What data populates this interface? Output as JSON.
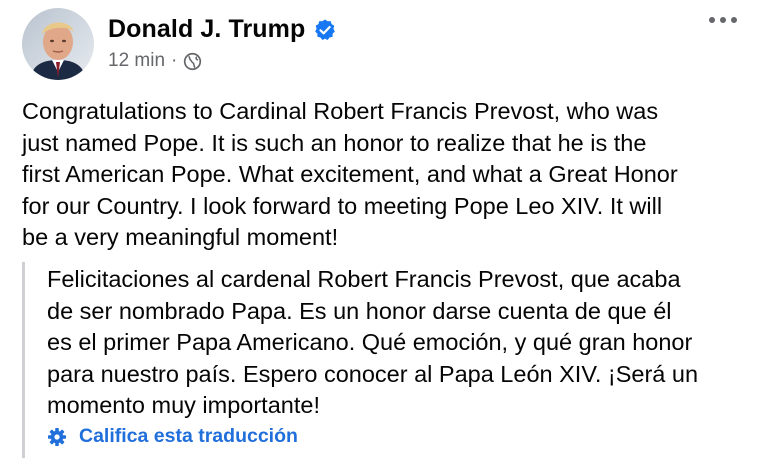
{
  "post": {
    "author": "Donald J. Trump",
    "verified": true,
    "timestamp": "12 min",
    "separator": "·",
    "audience_icon": "globe-icon",
    "more_icon": "more-options-icon",
    "text_lines": [
      "Congratulations to Cardinal Robert Francis Prevost, who was",
      "just named Pope. It is such an honor to realize that he is the",
      "first American Pope. What excitement, and what a Great Honor",
      "for our Country. I look forward to meeting Pope Leo XIV. It will",
      "be a very meaningful moment!"
    ]
  },
  "translation": {
    "text_lines": [
      "Felicitaciones al cardenal Robert Francis Prevost, que acaba",
      "de ser nombrado Papa. Es un honor darse cuenta de que él",
      "es el primer Papa Americano. Qué emoción, y qué gran honor",
      "para nuestro país. Espero conocer al Papa León XIV. ¡Será un",
      "momento muy importante!"
    ],
    "rate_label": "Califica esta traducción",
    "rate_icon": "gear-icon"
  },
  "colors": {
    "text": "#050505",
    "secondary": "#65676b",
    "link": "#216fdb",
    "verified_badge": "#1877f2",
    "quote_border": "#ced0d4"
  }
}
